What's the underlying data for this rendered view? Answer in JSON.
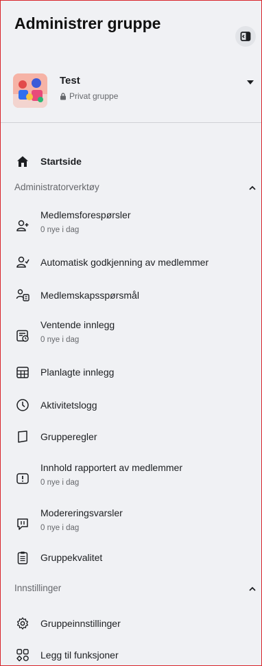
{
  "header": {
    "title": "Administrer gruppe"
  },
  "group": {
    "name": "Test",
    "privacy": "Privat gruppe"
  },
  "nav": {
    "home": "Startside"
  },
  "sections": [
    {
      "title": "Administratorverktøy",
      "items": [
        {
          "label": "Medlemsforespørsler",
          "sub": "0 nye i dag",
          "icon": "member-requests-icon"
        },
        {
          "label": "Automatisk godkjenning av medlemmer",
          "icon": "auto-approve-icon"
        },
        {
          "label": "Medlemskapsspørsmål",
          "icon": "membership-questions-icon"
        },
        {
          "label": "Ventende innlegg",
          "sub": "0 nye i dag",
          "icon": "pending-posts-icon"
        },
        {
          "label": "Planlagte innlegg",
          "icon": "scheduled-posts-icon"
        },
        {
          "label": "Aktivitetslogg",
          "icon": "activity-log-icon"
        },
        {
          "label": "Grupperegler",
          "icon": "group-rules-icon"
        },
        {
          "label": "Innhold rapportert av medlemmer",
          "sub": "0 nye i dag",
          "icon": "reported-content-icon"
        },
        {
          "label": "Modereringsvarsler",
          "sub": "0 nye i dag",
          "icon": "moderation-alerts-icon"
        },
        {
          "label": "Gruppekvalitet",
          "icon": "group-quality-icon"
        }
      ]
    },
    {
      "title": "Innstillinger",
      "items": [
        {
          "label": "Gruppeinnstillinger",
          "icon": "gear-icon"
        },
        {
          "label": "Legg til funksjoner",
          "icon": "add-features-icon"
        }
      ]
    }
  ]
}
